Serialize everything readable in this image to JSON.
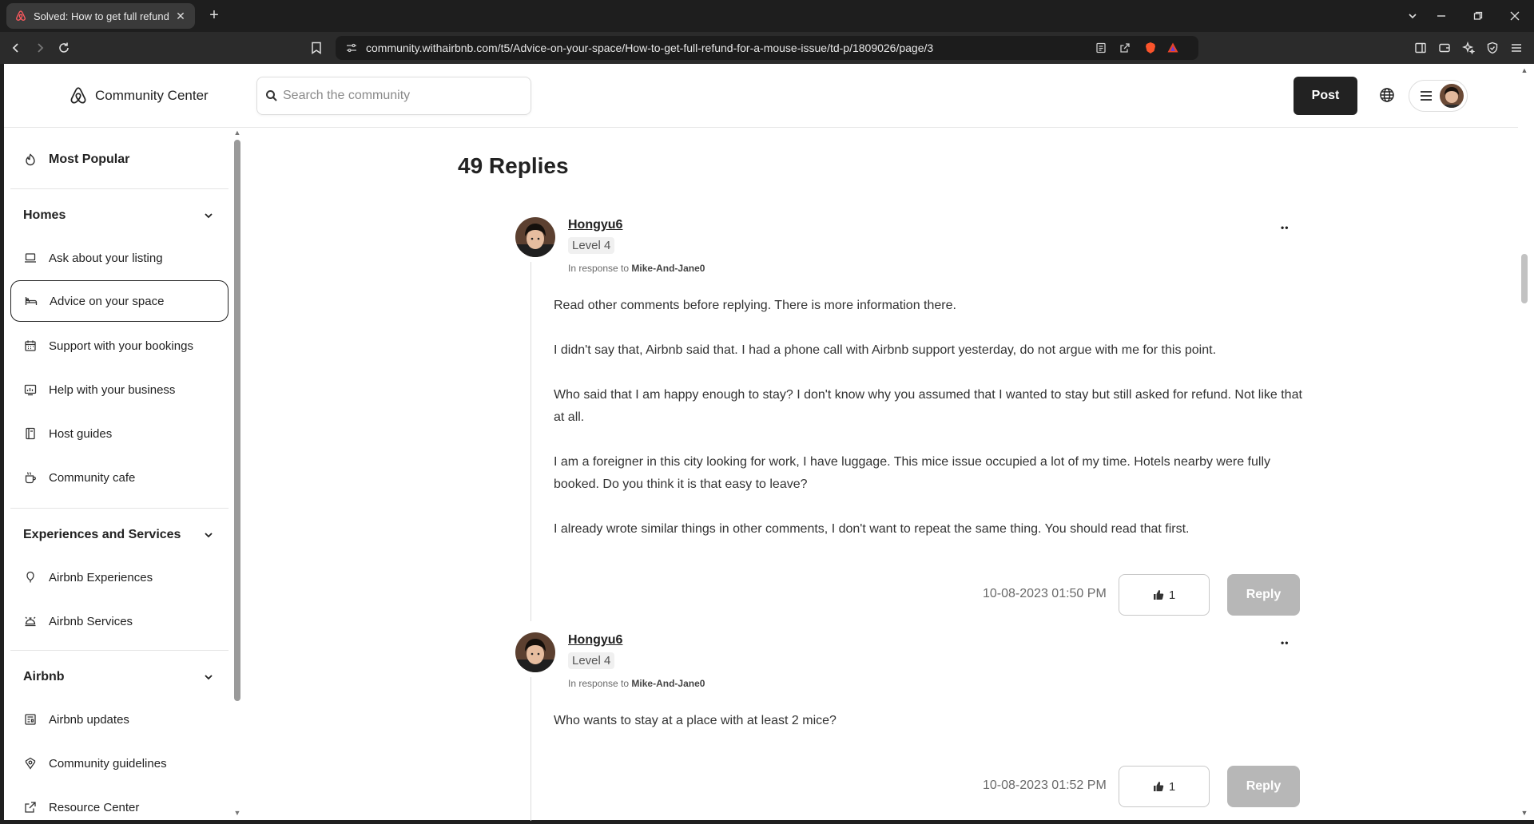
{
  "browser": {
    "tab_title": "Solved: How to get full refund fo",
    "url": "community.withairbnb.com/t5/Advice-on-your-space/How-to-get-full-refund-for-a-mouse-issue/td-p/1809026/page/3"
  },
  "header": {
    "logo_text": "Community Center",
    "search_placeholder": "Search the community",
    "post_label": "Post"
  },
  "sidebar": {
    "most_popular": "Most Popular",
    "sections": [
      {
        "title": "Homes",
        "items": [
          {
            "label": "Ask about your listing",
            "icon": "laptop-icon"
          },
          {
            "label": "Advice on your space",
            "icon": "bed-icon",
            "active": true
          },
          {
            "label": "Support with your bookings",
            "icon": "calendar-icon"
          },
          {
            "label": "Help with your business",
            "icon": "chart-icon"
          },
          {
            "label": "Host guides",
            "icon": "book-icon"
          },
          {
            "label": "Community cafe",
            "icon": "coffee-icon"
          }
        ]
      },
      {
        "title": "Experiences and Services",
        "items": [
          {
            "label": "Airbnb Experiences",
            "icon": "balloon-icon"
          },
          {
            "label": "Airbnb Services",
            "icon": "service-bell-icon"
          }
        ]
      },
      {
        "title": "Airbnb",
        "items": [
          {
            "label": "Airbnb updates",
            "icon": "news-icon"
          },
          {
            "label": "Community guidelines",
            "icon": "shield-icon"
          },
          {
            "label": "Resource Center",
            "icon": "external-link-icon"
          }
        ]
      }
    ]
  },
  "main": {
    "replies_title": "49 Replies",
    "replies": [
      {
        "username": "Hongyu6",
        "level": "Level 4",
        "in_response_prefix": "In response to",
        "in_response_to": "Mike-And-Jane0",
        "paragraphs": [
          "Read other comments before replying. There is more information there.",
          "I didn't say that, Airbnb said that. I had a phone call with Airbnb support yesterday, do not argue with me for this point.",
          "Who said that I am happy enough to stay? I don't know why you assumed that I wanted to stay but still asked for refund. Not like that at all.",
          "I am a foreigner in this city looking for work, I have luggage. This mice issue occupied a lot of my time. Hotels nearby were fully booked. Do you think it is that easy to leave?",
          "I already wrote similar things in other comments, I don't want to repeat the same thing. You should read that first."
        ],
        "date": "10-08-2023 01:50 PM",
        "likes": "1",
        "reply_label": "Reply"
      },
      {
        "username": "Hongyu6",
        "level": "Level 4",
        "in_response_prefix": "In response to",
        "in_response_to": "Mike-And-Jane0",
        "paragraphs": [
          "Who wants to stay at a place with at least 2 mice?"
        ],
        "date": "10-08-2023 01:52 PM",
        "likes": "1",
        "reply_label": "Reply"
      }
    ]
  },
  "colors": {
    "brand": "#FF5A5F",
    "post_button": "#222222",
    "reply_button_disabled": "#B7B7B7"
  }
}
